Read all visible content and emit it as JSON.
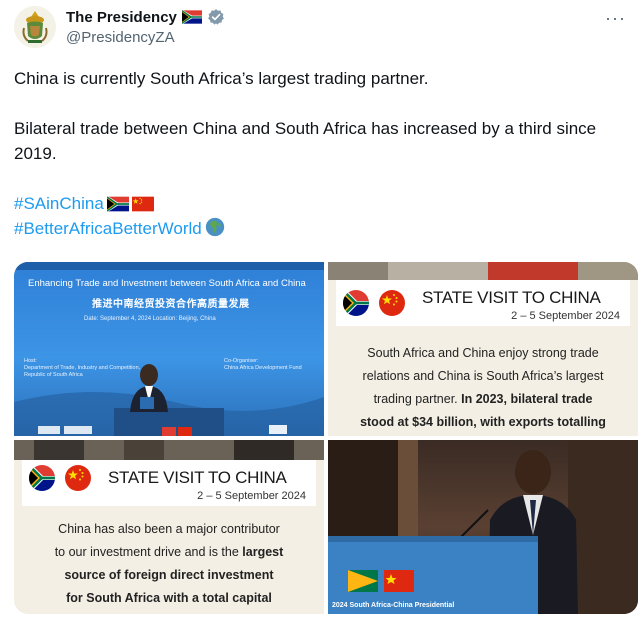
{
  "author": {
    "display_name": "The Presidency",
    "handle": "@PresidencyZA"
  },
  "menu": {
    "more_label": "···"
  },
  "tweet": {
    "paragraph1": "China is currently South Africa’s largest trading partner.",
    "paragraph2": "Bilateral trade between China and South Africa has increased by a third since 2019.",
    "hashtag1": "#SAinChina",
    "hashtag2": "#BetterAfricaBetterWorld"
  },
  "media": {
    "image1": {
      "title": "Enhancing Trade and Investment between South Africa and China",
      "subtitle": "推进中南经贸投资合作高质量发展",
      "date_line": "Date: September 4, 2024   Location: Beijing, China",
      "host_label": "Host:",
      "host_text": "Department of Trade, Industry and Competition, Republic of South Africa",
      "coorg_label": "Co-Organiser:",
      "coorg_text": "China Africa Development Fund"
    },
    "image2": {
      "banner_title": "STATE VISIT TO CHINA",
      "banner_dates": "2 – 5 September 2024",
      "body_line1": "South Africa and China enjoy strong trade",
      "body_line2": "relations and China is South Africa’s largest",
      "body_line3_normal": "trading partner. ",
      "body_line3_bold": "In 2023, bilateral trade",
      "body_line4_bold": "stood at $34 billion, with exports totalling"
    },
    "image3": {
      "banner_title": "STATE VISIT TO CHINA",
      "banner_dates": "2 – 5 September 2024",
      "body_line1": "China has also been a major contributor",
      "body_line2_normal": "to our investment drive and is the ",
      "body_line2_bold": "largest",
      "body_line3_bold": "source of foreign direct investment",
      "body_line4_bold": "for South Africa with a total capital"
    },
    "image4": {
      "podium_text": "2024 South Africa-China Presidential"
    }
  },
  "colors": {
    "link": "#1d9bf0",
    "text": "#0f1419",
    "secondary": "#536471",
    "flag_red": "#de2910"
  },
  "icons": [
    "coat-of-arms-icon",
    "south-africa-flag-icon",
    "verified-badge-icon",
    "china-flag-icon",
    "globe-africa-icon",
    "more-icon"
  ]
}
